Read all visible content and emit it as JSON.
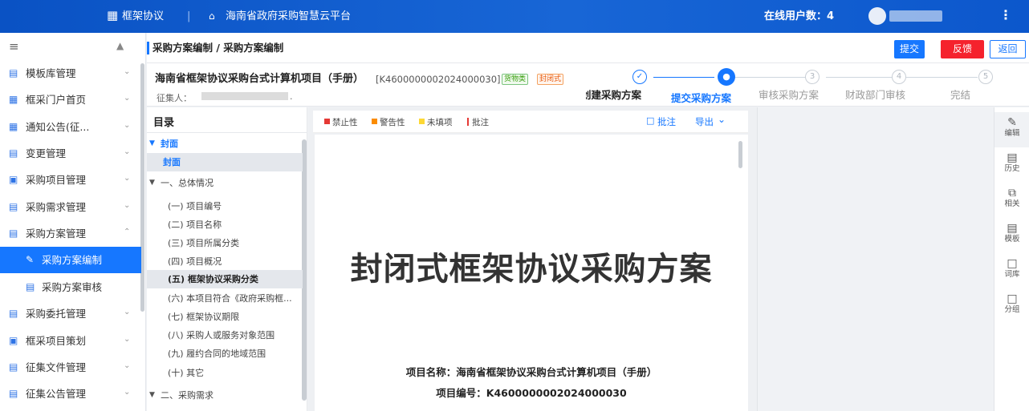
{
  "topbar": {
    "app_icon": "grid-icon",
    "app_title": "框架协议",
    "home_icon": "home-icon",
    "platform_title": "海南省政府采购智慧云平台",
    "online_label": "在线用户数：4",
    "more_icon": "more-vertical-icon",
    "colors": {
      "bg": "#1565d8"
    }
  },
  "sidebar": {
    "collapse_icon": "hamburger-icon",
    "pin_icon": "pin-icon",
    "items": [
      {
        "label": "模板库管理",
        "icon": "template-icon"
      },
      {
        "label": "框采门户首页",
        "icon": "grid-icon"
      },
      {
        "label": "通知公告(征...",
        "icon": "grid-icon"
      },
      {
        "label": "变更管理",
        "icon": "change-icon"
      },
      {
        "label": "采购项目管理",
        "icon": "folder-icon"
      },
      {
        "label": "采购需求管理",
        "icon": "document-icon"
      },
      {
        "label": "采购方案管理",
        "icon": "document-icon"
      },
      {
        "label": "采购方案编制",
        "icon": "edit-doc-icon"
      },
      {
        "label": "采购方案审核",
        "icon": "review-doc-icon"
      },
      {
        "label": "采购委托管理",
        "icon": "document-icon"
      },
      {
        "label": "框采项目策划",
        "icon": "folder-icon"
      },
      {
        "label": "征集文件管理",
        "icon": "file-icon"
      },
      {
        "label": "征集公告管理",
        "icon": "file-icon"
      }
    ]
  },
  "breadcrumb": "采购方案编制 / 采购方案编制",
  "buttons": {
    "submit": "提交",
    "feedback": "反馈",
    "back": "返回"
  },
  "project": {
    "title": "海南省框架协议采购台式计算机项目（手册）",
    "code": "[K4600000002024000030]",
    "tag_goods": "货物类",
    "tag_closed": "封闭式",
    "collector_label": "征集人：",
    "collector_value": "."
  },
  "steps": [
    {
      "label": "创建采购方案",
      "state": "done"
    },
    {
      "label": "提交采购方案",
      "state": "current"
    },
    {
      "label": "审核采购方案",
      "state": "pending",
      "num": "3"
    },
    {
      "label": "财政部门审核",
      "state": "pending",
      "num": "4"
    },
    {
      "label": "完结",
      "state": "pending",
      "num": "5"
    }
  ],
  "toc": {
    "title": "目录",
    "items": [
      "封面",
      "封面",
      "一、总体情况",
      "(一) 项目编号",
      "(二) 项目名称",
      "(三) 项目所属分类",
      "(四) 项目概况",
      "(五) 框架协议采购分类",
      "(六) 本项目符合《政府采购框...",
      "(七) 框架协议期限",
      "(八) 采购人或服务对象范围",
      "(九) 履约合同的地域范围",
      "(十) 其它",
      "二、采购需求"
    ]
  },
  "legend": {
    "items": [
      {
        "label": "禁止性",
        "color": "#e53935"
      },
      {
        "label": "警告性",
        "color": "#fb8c00"
      },
      {
        "label": "未填项",
        "color": "#fdd835"
      },
      {
        "label": "批注",
        "color": "#e53935"
      }
    ],
    "comment": "批注",
    "export": "导出"
  },
  "document": {
    "heading": "封闭式框架协议采购方案",
    "name_line": "项目名称：海南省框架协议采购台式计算机项目（手册）",
    "code_line": "项目编号：K4600000002024000030"
  },
  "tools": [
    {
      "label": "编辑",
      "icon": "pen-icon"
    },
    {
      "label": "历史",
      "icon": "history-icon"
    },
    {
      "label": "相关",
      "icon": "copy-icon"
    },
    {
      "label": "模板",
      "icon": "template-icon"
    },
    {
      "label": "词库",
      "icon": "book-icon"
    },
    {
      "label": "分组",
      "icon": "group-icon"
    }
  ]
}
